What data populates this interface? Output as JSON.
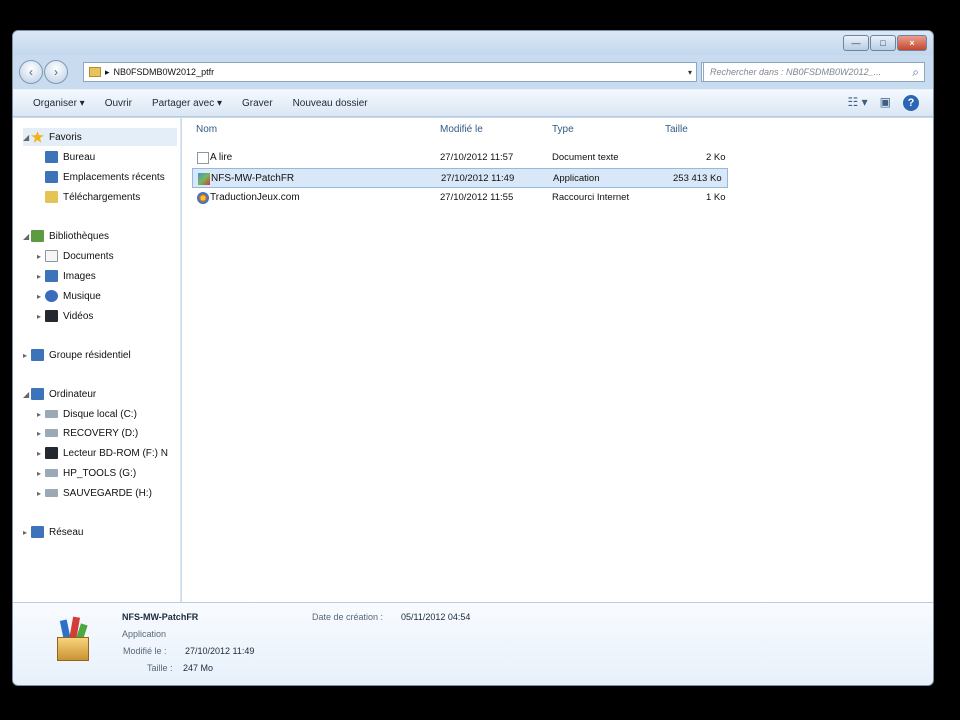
{
  "window": {
    "address": "NB0FSDMB0W2012_ptfr",
    "search_placeholder": "Rechercher dans : NB0FSDMB0W2012_..."
  },
  "toolbar": {
    "organise": "Organiser ▾",
    "open": "Ouvrir",
    "share": "Partager avec ▾",
    "burn": "Graver",
    "new_folder": "Nouveau dossier"
  },
  "navigation": {
    "favorites": "Favoris",
    "desktop": "Bureau",
    "recent": "Emplacements récents",
    "downloads": "Téléchargements",
    "libraries": "Bibliothèques",
    "documents": "Documents",
    "images": "Images",
    "music": "Musique",
    "videos": "Vidéos",
    "homegroup": "Groupe résidentiel",
    "computer": "Ordinateur",
    "drive_c": "Disque local (C:)",
    "drive_d": "RECOVERY (D:)",
    "drive_f": "Lecteur BD-ROM (F:) N",
    "drive_g": "HP_TOOLS (G:)",
    "drive_h": "SAUVEGARDE (H:)",
    "network": "Réseau"
  },
  "columns": {
    "name": "Nom",
    "modified": "Modifié le",
    "type": "Type",
    "size": "Taille"
  },
  "files": [
    {
      "name": "A lire",
      "modified": "27/10/2012 11:57",
      "type": "Document texte",
      "size": "2 Ko",
      "icon": "text-file-icon"
    },
    {
      "name": "NFS-MW-PatchFR",
      "modified": "27/10/2012 11:49",
      "type": "Application",
      "size": "253 413 Ko",
      "icon": "application-icon"
    },
    {
      "name": "TraductionJeux.com",
      "modified": "27/10/2012 11:55",
      "type": "Raccourci Internet",
      "size": "1 Ko",
      "icon": "internet-shortcut-icon"
    }
  ],
  "details": {
    "name": "NFS-MW-PatchFR",
    "type": "Application",
    "modified_label": "Modifié le :",
    "modified": "27/10/2012 11:49",
    "size_label": "Taille :",
    "size": "247 Mo",
    "created_label": "Date de création :",
    "created": "05/11/2012 04:54"
  },
  "colors": {
    "accent": "#3d73b8",
    "selection": "#d8e8f8"
  }
}
